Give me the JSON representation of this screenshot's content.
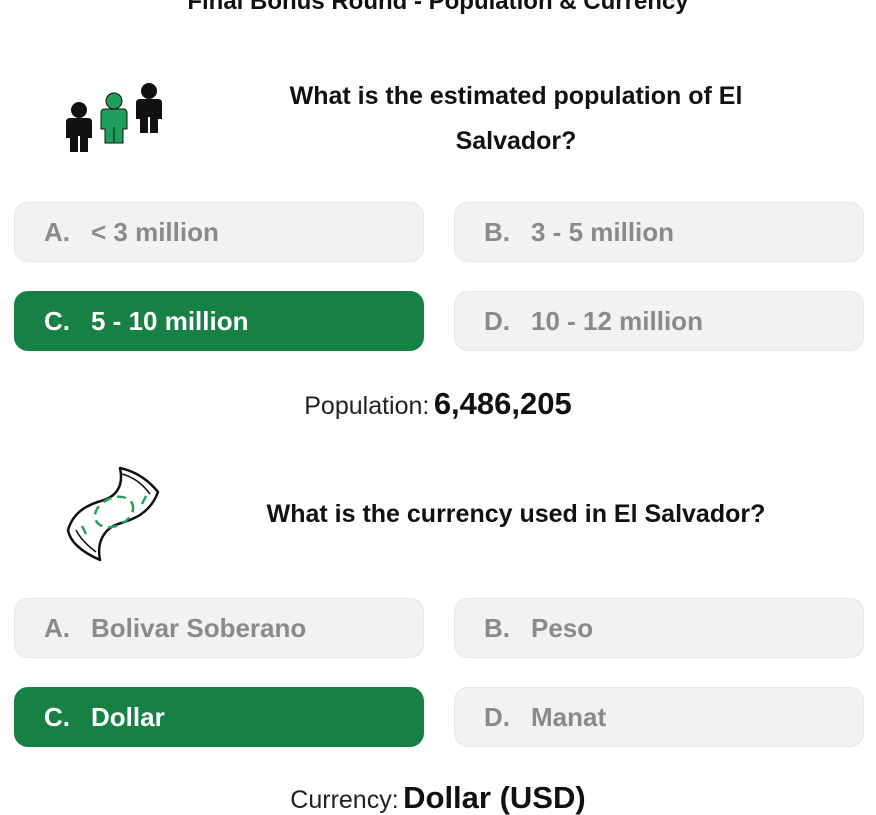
{
  "round_title": "Final Bonus Round - Population & Currency",
  "questions": [
    {
      "icon": "people-icon",
      "text": "What is the estimated population of El Salvador?",
      "options": [
        {
          "letter": "A.",
          "text": "< 3 million",
          "correct": false
        },
        {
          "letter": "B.",
          "text": "3 - 5 million",
          "correct": false
        },
        {
          "letter": "C.",
          "text": "5 - 10 million",
          "correct": true
        },
        {
          "letter": "D.",
          "text": "10 - 12 million",
          "correct": false
        }
      ],
      "answer_label": "Population:",
      "answer_value": "6,486,205"
    },
    {
      "icon": "money-icon",
      "text": "What is the currency used in El Salvador?",
      "options": [
        {
          "letter": "A.",
          "text": "Bolivar Soberano",
          "correct": false
        },
        {
          "letter": "B.",
          "text": "Peso",
          "correct": false
        },
        {
          "letter": "C.",
          "text": "Dollar",
          "correct": true
        },
        {
          "letter": "D.",
          "text": "Manat",
          "correct": false
        }
      ],
      "answer_label": "Currency:",
      "answer_value": "Dollar (USD)"
    }
  ],
  "colors": {
    "correct_bg": "#168045",
    "option_bg": "#f1f2f4",
    "option_text": "#8a8a8a",
    "people_icon_accent": "#1e9e5a",
    "money_icon_accent": "#22a35a"
  }
}
